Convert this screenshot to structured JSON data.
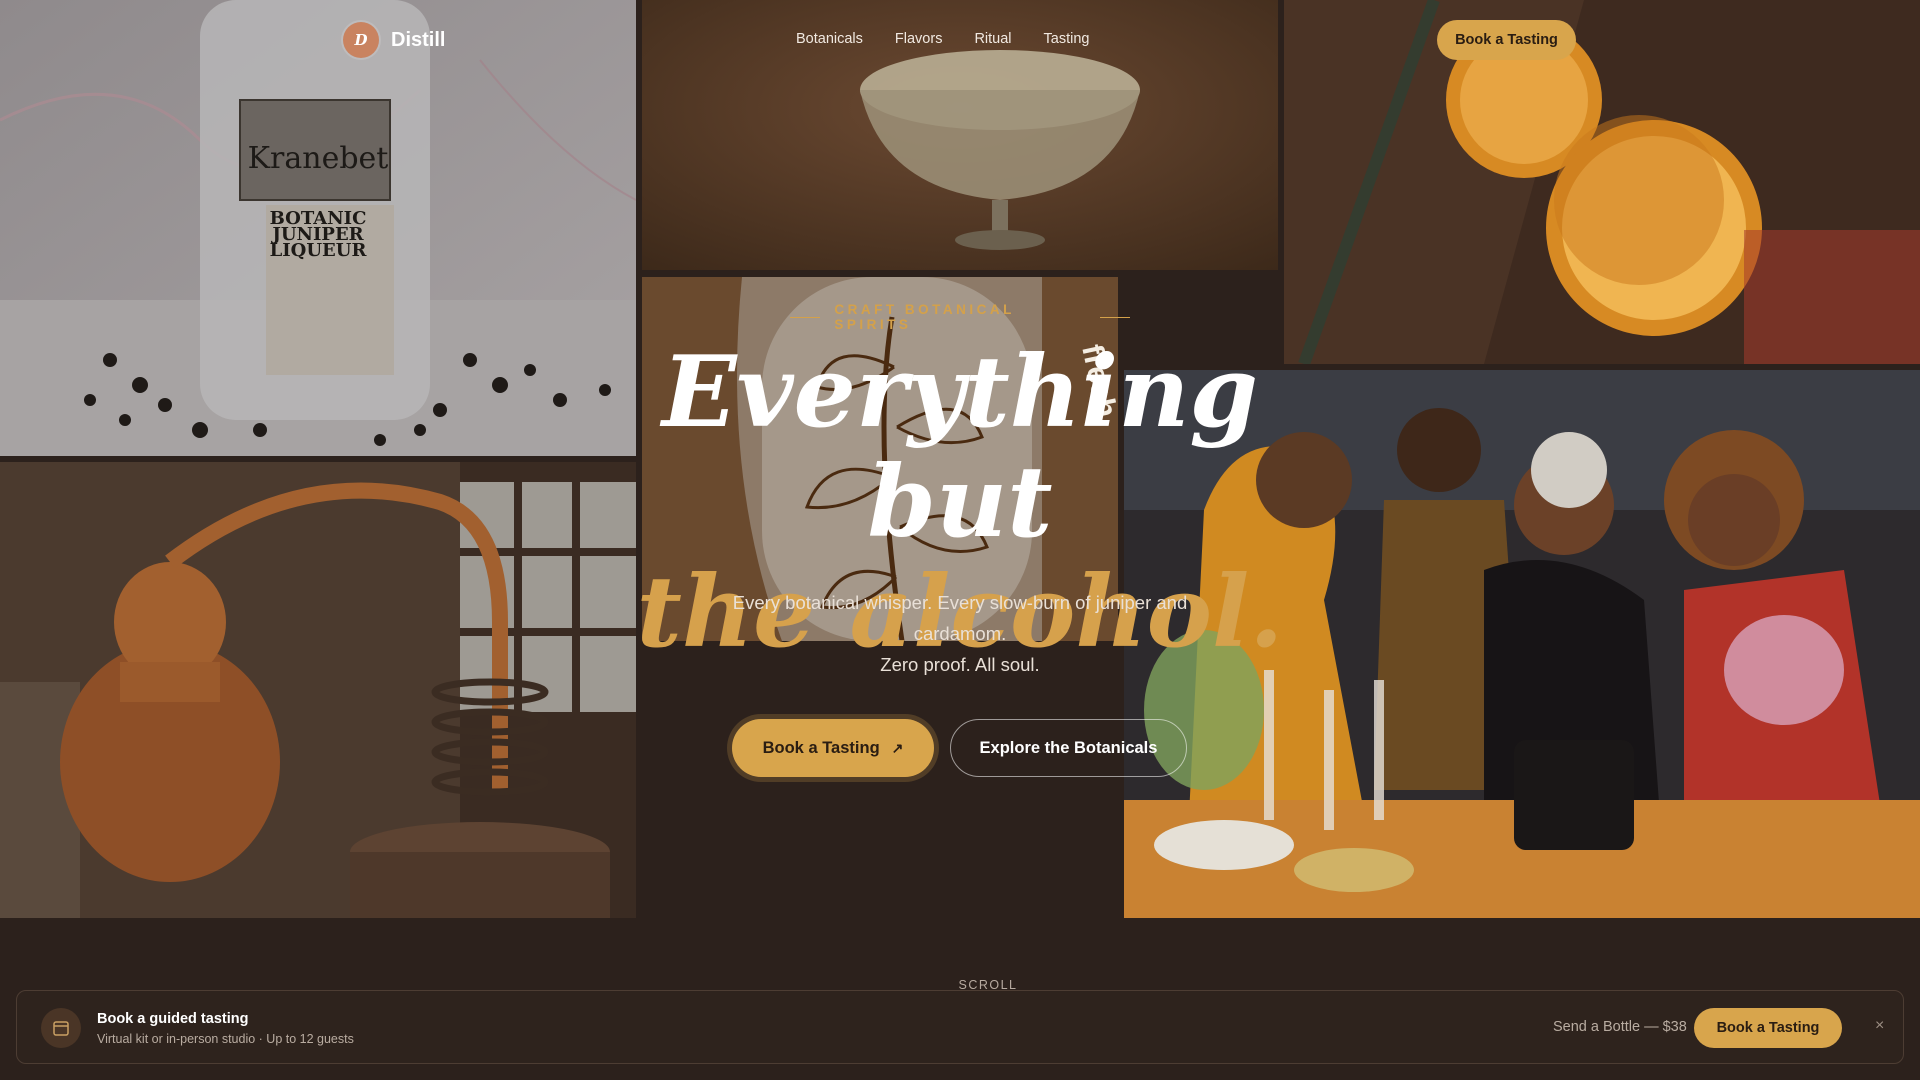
{
  "brand": {
    "initial": "D",
    "name": "Distill"
  },
  "nav": {
    "links": [
      "Botanicals",
      "Flavors",
      "Ritual",
      "Tasting"
    ],
    "cta_label": "Book a Tasting"
  },
  "hero": {
    "eyebrow": "CRAFT BOTANICAL SPIRITS",
    "headline_line1": "Everything but",
    "headline_line2": "the alcohol.",
    "sub_line1": "Every botanical whisper. Every slow-burn of juniper and cardamom.",
    "sub_line2": "Zero proof. All soul.",
    "primary_cta": "Book a Tasting",
    "primary_cta_icon": "arrow-up-right-icon",
    "secondary_cta": "Explore the Botanicals",
    "scroll_hint": "SCROLL"
  },
  "images": {
    "bottle": {
      "brand": "Kranebet",
      "text1": "BOTANIC",
      "text2": "JUNIPER",
      "text3": "LIQUEUR"
    },
    "label_word": "fresh"
  },
  "booking_bar": {
    "title": "Book a guided tasting",
    "subtitle": "Virtual kit or in-person studio · Up to 12 guests",
    "gift_link": "Send a Bottle — $38",
    "cta_label": "Book a Tasting",
    "close_icon": "×"
  },
  "colors": {
    "background": "#2c211c",
    "accent_gold": "#d8a54c",
    "brand_badge": "#c98360"
  }
}
